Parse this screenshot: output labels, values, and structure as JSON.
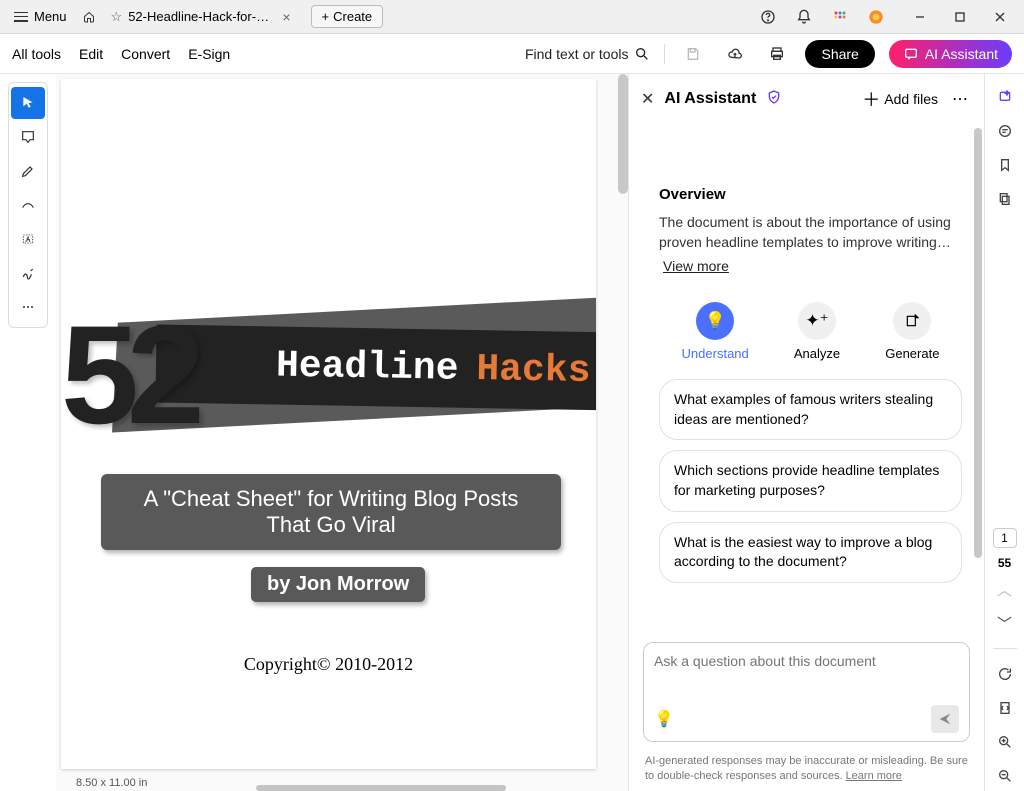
{
  "titlebar": {
    "menu": "Menu",
    "tab_label": "52-Headline-Hack-for-T…",
    "create": "Create"
  },
  "toolbar": {
    "all_tools": "All tools",
    "edit": "Edit",
    "convert": "Convert",
    "esign": "E-Sign",
    "find": "Find text or tools",
    "share": "Share",
    "ai": "AI Assistant"
  },
  "doc": {
    "big_num": "52",
    "headline": "Headline",
    "hacks": "Hacks",
    "cheat": "A \"Cheat Sheet\" for Writing Blog Posts That Go Viral",
    "author": "by Jon Morrow",
    "copyright": "Copyright© 2010-2012",
    "dims": "8.50 x 11.00 in"
  },
  "ai": {
    "title": "AI Assistant",
    "add": "Add files",
    "overview_h": "Overview",
    "overview_t": "The document is about the importance of using proven headline templates to improve writing…",
    "viewmore": "View more",
    "actions": {
      "understand": "Understand",
      "analyze": "Analyze",
      "generate": "Generate"
    },
    "suggestions": [
      "What examples of famous writers stealing ideas are mentioned?",
      "Which sections provide headline templates for marketing purposes?",
      "What is the easiest way to improve a blog according to the document?"
    ],
    "placeholder": "Ask a question about this document",
    "disclaimer_a": "AI-generated responses may be inaccurate or misleading. Be sure to double-check responses and sources. ",
    "disclaimer_link": "Learn more"
  },
  "pages": {
    "current": "1",
    "total": "55"
  }
}
